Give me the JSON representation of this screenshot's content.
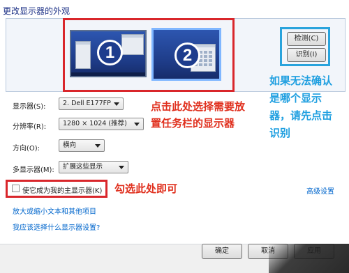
{
  "window": {
    "title": "更改显示器的外观"
  },
  "monitors": [
    {
      "number": "1"
    },
    {
      "number": "2"
    }
  ],
  "buttons": {
    "detect": "检测(C)",
    "identify": "识别(I)",
    "ok": "确定",
    "cancel": "取消",
    "apply": "应用"
  },
  "settings": {
    "display": {
      "label": "显示器(S):",
      "value": "2. Dell E177FP"
    },
    "resolution": {
      "label": "分辨率(R):",
      "value": "1280 × 1024 (推荐)"
    },
    "orientation": {
      "label": "方向(O):",
      "value": "横向"
    },
    "multiple_displays": {
      "label": "多显示器(M):",
      "value": "扩展这些显示"
    }
  },
  "main_display_checkbox": {
    "label": "使它成为我的主显示器(K)",
    "checked": false
  },
  "links": {
    "advanced": "高级设置",
    "enlarge_text": "放大或缩小文本和其他项目",
    "which_settings": "我应该选择什么显示器设置?"
  },
  "annotations": {
    "select_display": [
      "点击此处选择需要放",
      "置任务栏的显示器"
    ],
    "check_here": "勾选此处即可",
    "identify_hint": [
      "如果无法确认",
      "是哪个显示",
      "器，请先点击",
      "识别"
    ]
  },
  "colors": {
    "annotation_red": "#d9262b",
    "annotation_blue": "#29a3dc",
    "monitor_blue": "#1f3f92",
    "link_blue": "#0066cc"
  }
}
